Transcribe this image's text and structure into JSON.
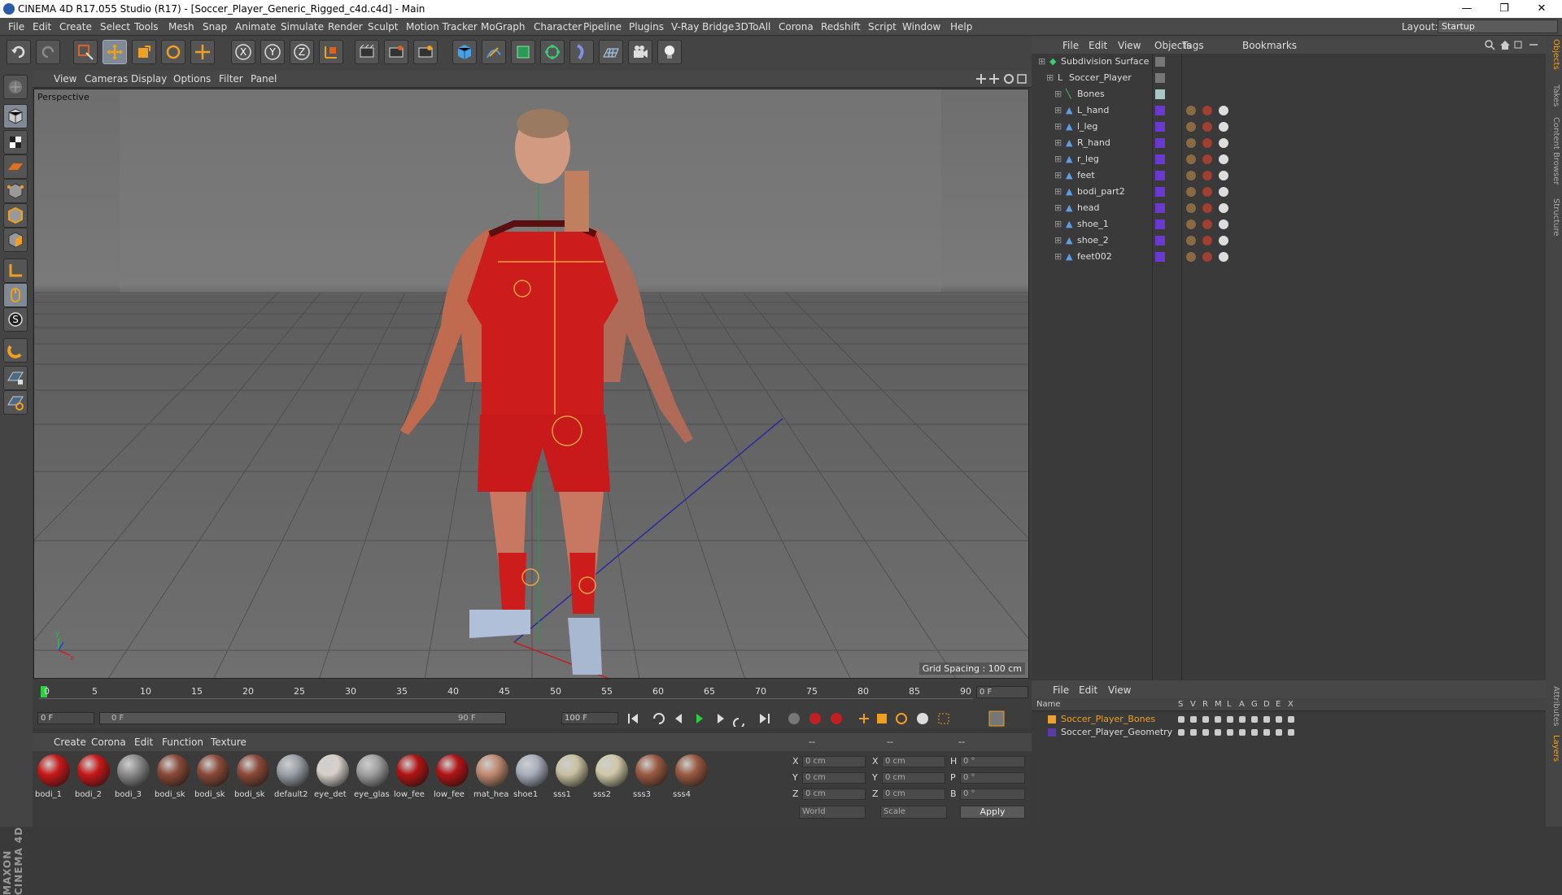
{
  "window": {
    "title": "CINEMA 4D R17.055 Studio (R17) - [Soccer_Player_Generic_Rigged_c4d.c4d] - Main",
    "minimize": "—",
    "maximize": "❐",
    "close": "✕"
  },
  "menubar": {
    "items": [
      "File",
      "Edit",
      "Create",
      "Select",
      "Tools",
      "Mesh",
      "Snap",
      "Animate",
      "Simulate",
      "Render",
      "Sculpt",
      "Motion Tracker",
      "MoGraph",
      "Character",
      "Pipeline",
      "Plugins",
      "V-Ray Bridge",
      "3DToAll",
      "Corona",
      "Redshift",
      "Script",
      "Window",
      "Help"
    ],
    "layout_label": "Layout:",
    "layout_value": "Startup"
  },
  "viewport": {
    "menu": [
      "View",
      "Cameras",
      "Display",
      "Options",
      "Filter",
      "Panel"
    ],
    "camera_label": "Perspective",
    "grid_spacing": "Grid Spacing : 100 cm"
  },
  "timeline": {
    "ticks": [
      "0",
      "5",
      "10",
      "15",
      "20",
      "25",
      "30",
      "35",
      "40",
      "45",
      "50",
      "55",
      "60",
      "65",
      "70",
      "75",
      "80",
      "85",
      "90"
    ],
    "current_frame": "0 F",
    "start_field": "0 F",
    "range_start": "0 F",
    "range_end": "90 F",
    "end_field": "100 F"
  },
  "materials": {
    "menu": [
      "Create",
      "Corona",
      "Edit",
      "Function",
      "Texture"
    ],
    "items": [
      {
        "label": "bodi_1",
        "color": "#c81818"
      },
      {
        "label": "bodi_2",
        "color": "#c81818"
      },
      {
        "label": "bodi_3",
        "color": "#8a8a8a"
      },
      {
        "label": "bodi_sk",
        "color": "#8a4a38"
      },
      {
        "label": "bodi_sk",
        "color": "#8a4a38"
      },
      {
        "label": "bodi_sk",
        "color": "#8a4a38"
      },
      {
        "label": "default2",
        "color": "#9aa0a8"
      },
      {
        "label": "eye_det",
        "color": "#d8d0c8"
      },
      {
        "label": "eye_glas",
        "color": "#a0a0a0"
      },
      {
        "label": "low_fee",
        "color": "#b01414"
      },
      {
        "label": "low_fee",
        "color": "#b01414"
      },
      {
        "label": "mat_hea",
        "color": "#c08a70"
      },
      {
        "label": "shoe1",
        "color": "#a8aebc"
      },
      {
        "label": "sss1",
        "color": "#c8c0a0"
      },
      {
        "label": "sss2",
        "color": "#d0c8a8"
      },
      {
        "label": "sss3",
        "color": "#9a5a40"
      },
      {
        "label": "sss4",
        "color": "#9a5a40"
      }
    ]
  },
  "coords": {
    "header": [
      "--",
      "--",
      "--"
    ],
    "rows": [
      {
        "a": "X",
        "av": "0 cm",
        "b": "X",
        "bv": "0 cm",
        "c": "H",
        "cv": "0 °"
      },
      {
        "a": "Y",
        "av": "0 cm",
        "b": "Y",
        "bv": "0 cm",
        "c": "P",
        "cv": "0 °"
      },
      {
        "a": "Z",
        "av": "0 cm",
        "b": "Z",
        "bv": "0 cm",
        "c": "B",
        "cv": "0 °"
      }
    ],
    "mode1": "World",
    "mode2": "Scale",
    "apply": "Apply"
  },
  "objects": {
    "menu": [
      "File",
      "Edit",
      "View",
      "Objects",
      "Tags",
      "Bookmarks"
    ],
    "rows": [
      {
        "name": "Subdivision Surface",
        "indent": 0
      },
      {
        "name": "Soccer_Player",
        "indent": 1
      },
      {
        "name": "Bones",
        "indent": 2
      },
      {
        "name": "L_hand",
        "indent": 2
      },
      {
        "name": "l_leg",
        "indent": 2
      },
      {
        "name": "R_hand",
        "indent": 2
      },
      {
        "name": "r_leg",
        "indent": 2
      },
      {
        "name": "feet",
        "indent": 2
      },
      {
        "name": "bodi_part2",
        "indent": 2
      },
      {
        "name": "head",
        "indent": 2
      },
      {
        "name": "shoe_1",
        "indent": 2
      },
      {
        "name": "shoe_2",
        "indent": 2
      },
      {
        "name": "feet002",
        "indent": 2
      }
    ]
  },
  "layers": {
    "menu": [
      "File",
      "Edit",
      "View"
    ],
    "header": {
      "name": "Name",
      "cols": [
        "S",
        "V",
        "R",
        "M",
        "L",
        "A",
        "G",
        "D",
        "E",
        "X"
      ]
    },
    "rows": [
      {
        "name": "Soccer_Player_Bones",
        "color": "#f0a030"
      },
      {
        "name": "Soccer_Player_Geometry",
        "color": "#5a3aa8"
      }
    ]
  },
  "sidetabs": [
    "Objects",
    "Takes",
    "Content Browser",
    "Structure",
    "Attributes",
    "Layers"
  ],
  "maxon_logo": "MAXON CINEMA 4D"
}
